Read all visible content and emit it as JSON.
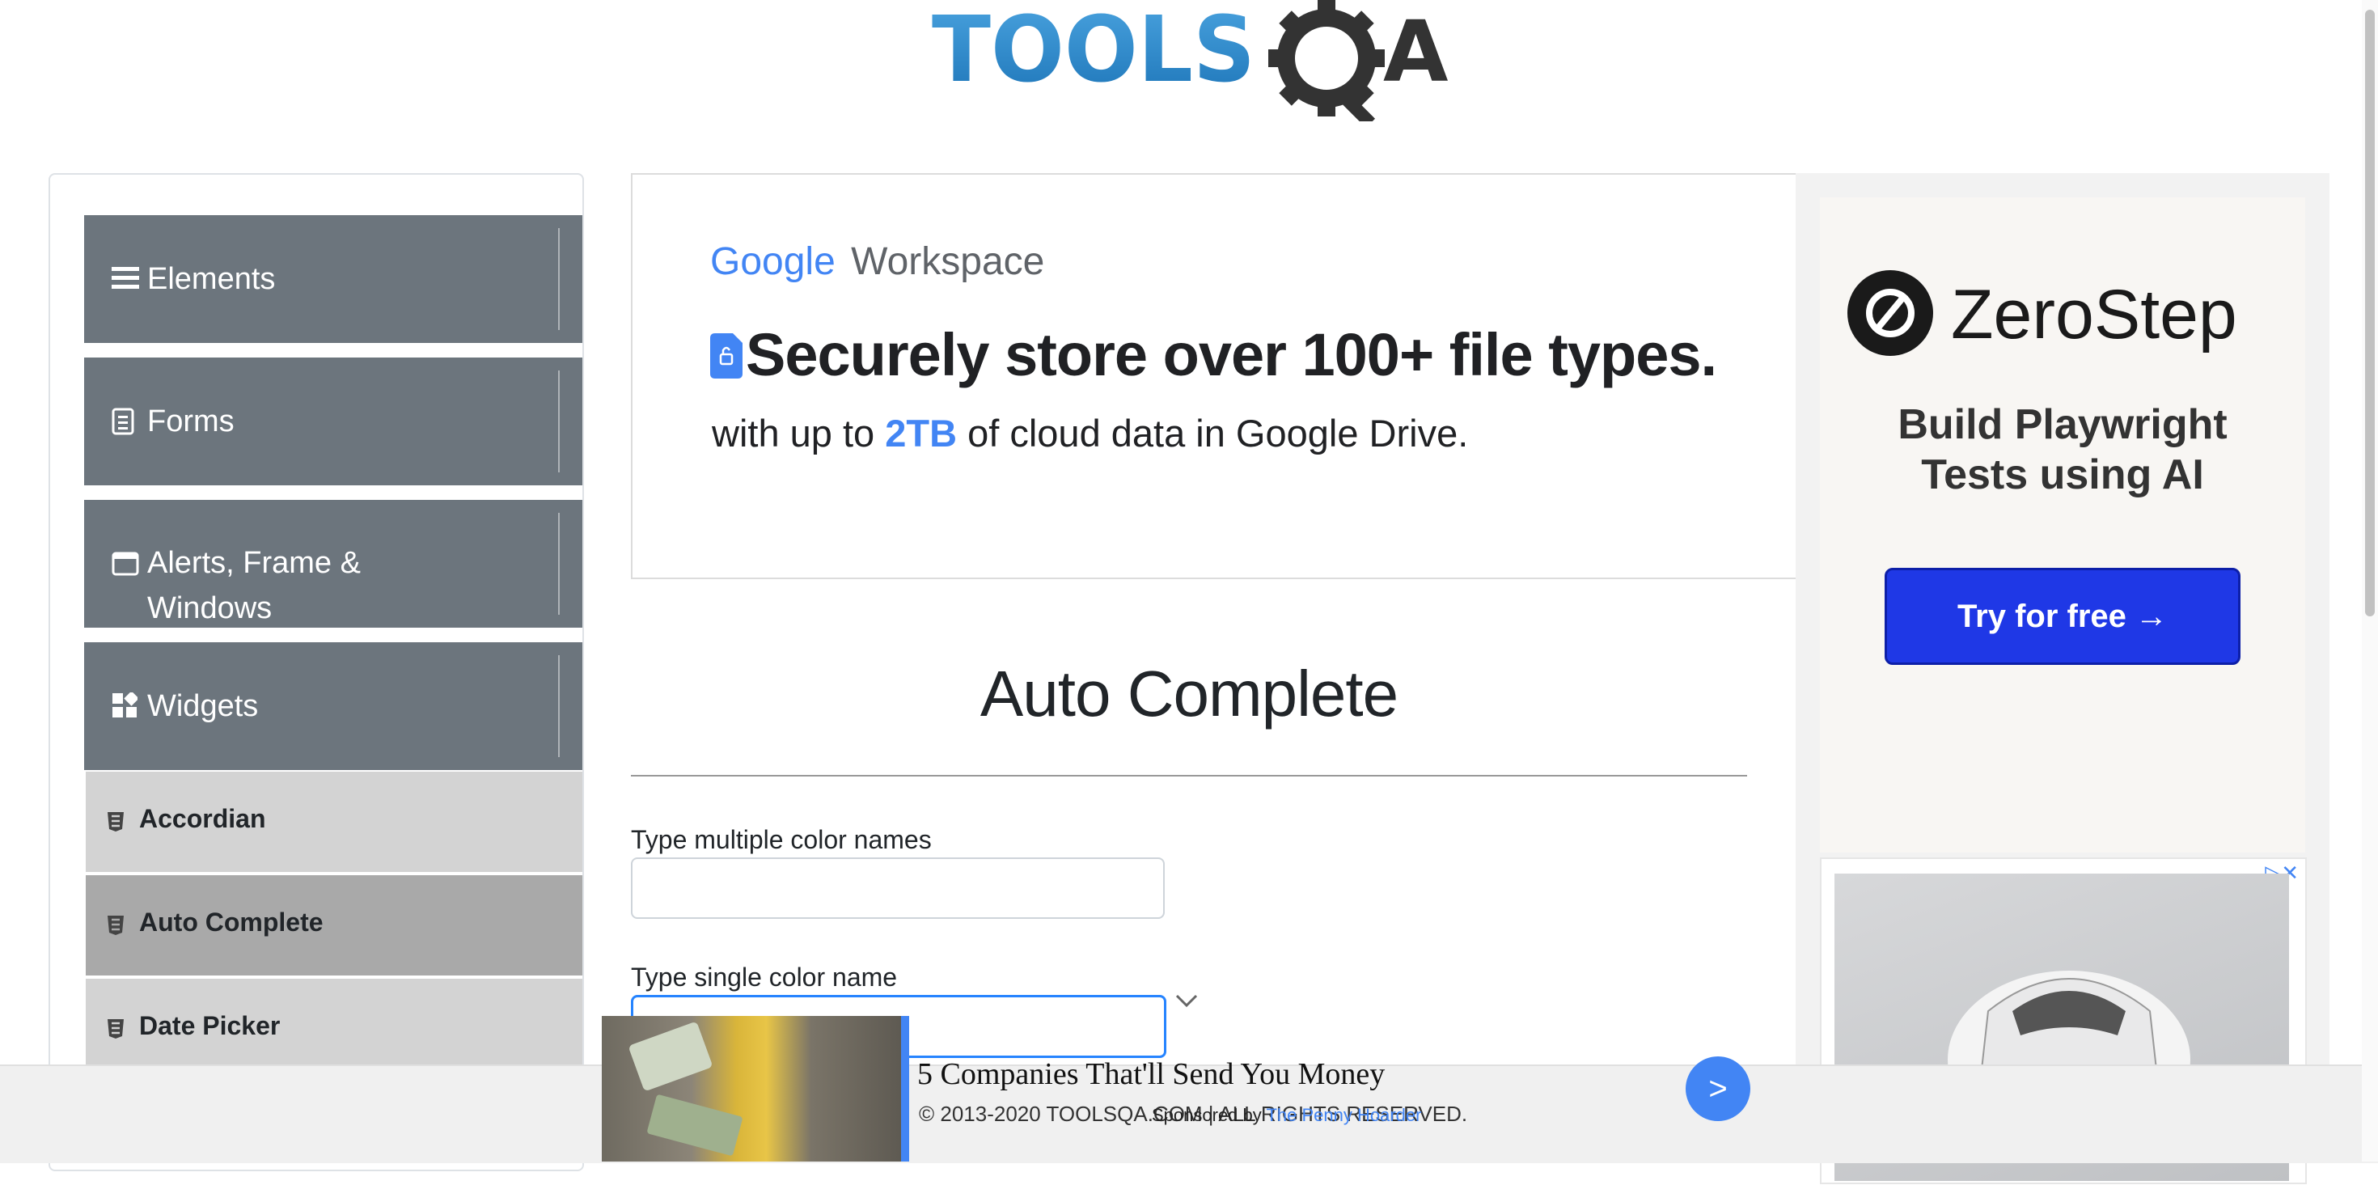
{
  "header": {
    "logo_text_left": "TOOLS",
    "logo_text_right": "A"
  },
  "sidebar": {
    "groups": [
      {
        "label": "Elements",
        "icon": "hamburger-icon",
        "arrow": "download-arrow-icon"
      },
      {
        "label": "Forms",
        "icon": "document-icon",
        "arrow": "download-arrow-icon"
      },
      {
        "label_line1": "Alerts, Frame &",
        "label_line2": "Windows",
        "icon": "browser-window-icon",
        "arrow": "download-arrow-icon"
      },
      {
        "label": "Widgets",
        "icon": "widgets-icon",
        "arrow": "upload-arrow-icon"
      }
    ],
    "items": [
      {
        "label": "Accordian",
        "icon": "html5-icon"
      },
      {
        "label": "Auto Complete",
        "icon": "html5-icon",
        "active": true
      },
      {
        "label": "Date Picker",
        "icon": "html5-icon"
      }
    ]
  },
  "main_ad": {
    "brand_google": "Google",
    "brand_workspace": "Workspace",
    "headline": "Securely store over 100+ file types.",
    "sub_pre": "with up to ",
    "sub_highlight": "2TB",
    "sub_post": " of cloud data in Google Drive."
  },
  "page": {
    "title": "Auto Complete",
    "multi_label": "Type multiple color names",
    "multi_value": "",
    "single_label": "Type single color name",
    "single_value": ""
  },
  "right_ad": {
    "brand": "ZeroStep",
    "tagline_line1": "Build Playwright",
    "tagline_line2": "Tests using AI",
    "cta": "Try for free →",
    "cta_color": "#1f38e6"
  },
  "bottom_ad": {
    "headline": "5 Companies That'll Send You Money",
    "sponsor_prefix": "Sponsored by",
    "sponsor": "The Penny Hoarder",
    "button": ">"
  },
  "footer": {
    "text": "© 2013-2020 TOOLSQA.COM | ALL RIGHTS RESERVED."
  },
  "colors": {
    "sidebar_group": "#6c757d",
    "accent": "#4285f4",
    "focus": "#2684ff"
  }
}
